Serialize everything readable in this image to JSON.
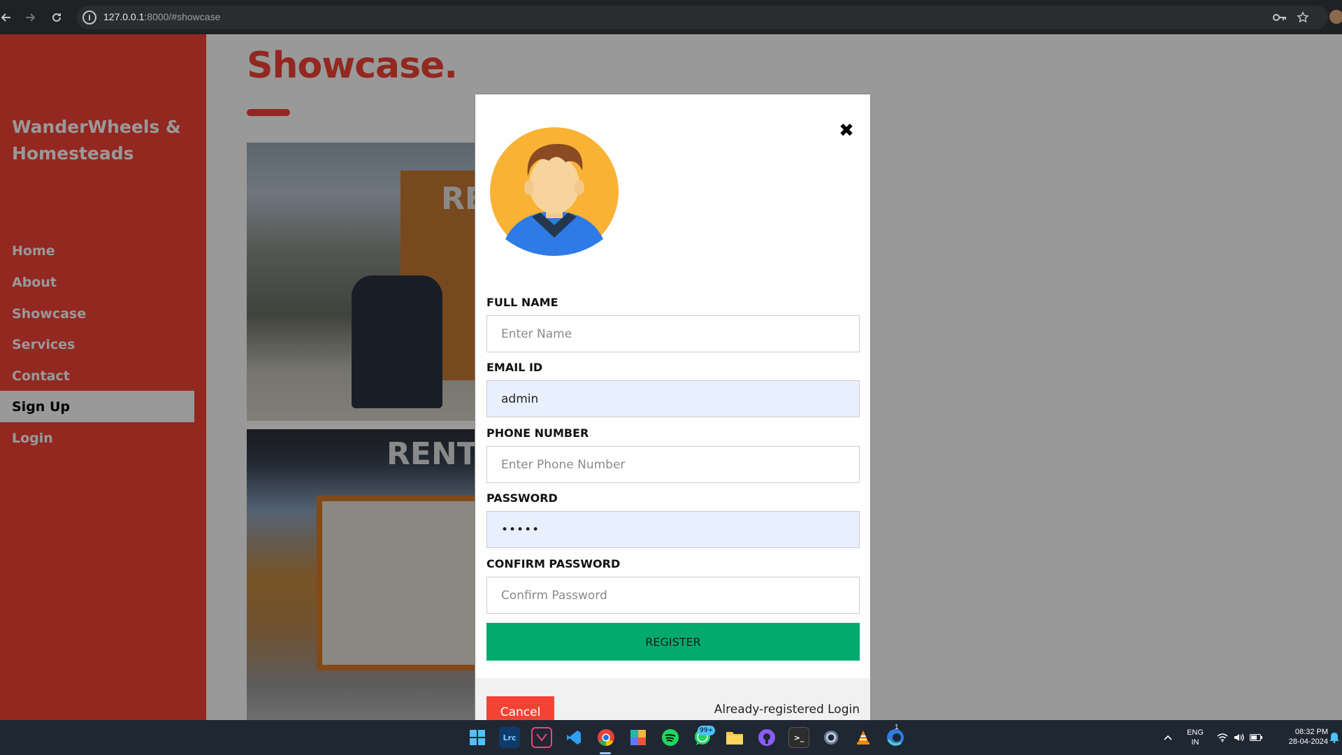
{
  "browser": {
    "url_host": "127.0.0.1",
    "url_rest": ":8000/#showcase",
    "info_glyph": "i"
  },
  "site": {
    "brand": "WanderWheels & Homesteads",
    "nav": [
      {
        "label": "Home",
        "active": false
      },
      {
        "label": "About",
        "active": false
      },
      {
        "label": "Showcase",
        "active": false
      },
      {
        "label": "Services",
        "active": false
      },
      {
        "label": "Contact",
        "active": false
      },
      {
        "label": "Sign Up",
        "active": true
      },
      {
        "label": "Login",
        "active": false
      }
    ],
    "page_title": "Showcase.",
    "photo_signs": [
      "RE",
      "RENT"
    ]
  },
  "modal": {
    "close_glyph": "✖",
    "fields": {
      "full_name": {
        "label": "FULL NAME",
        "placeholder": "Enter Name",
        "value": ""
      },
      "email": {
        "label": "EMAIL ID",
        "placeholder": "",
        "value": "admin"
      },
      "phone": {
        "label": "PHONE NUMBER",
        "placeholder": "Enter Phone Number",
        "value": ""
      },
      "password": {
        "label": "PASSWORD",
        "placeholder": "",
        "value": "•••••"
      },
      "confirm_password": {
        "label": "CONFIRM PASSWORD",
        "placeholder": "Confirm Password",
        "value": ""
      }
    },
    "register_label": "REGISTER",
    "cancel_label": "Cancel",
    "already_registered": "Already-registered Login"
  },
  "taskbar": {
    "apps": [
      "windows-start",
      "lrc",
      "app-pink",
      "vscode",
      "chrome",
      "photos",
      "spotify",
      "whatsapp",
      "file-explorer",
      "github",
      "terminal",
      "settings",
      "vlc",
      "edge-dev"
    ],
    "whatsapp_badge": "99+",
    "edge_badge": "1",
    "language": "ENG",
    "region": "IN",
    "time": "08:32 PM",
    "date": "28-04-2024"
  },
  "colors": {
    "accent_red": "#f44336",
    "register_green": "#04aa6d",
    "autofill_blue": "#e8f0fe"
  }
}
